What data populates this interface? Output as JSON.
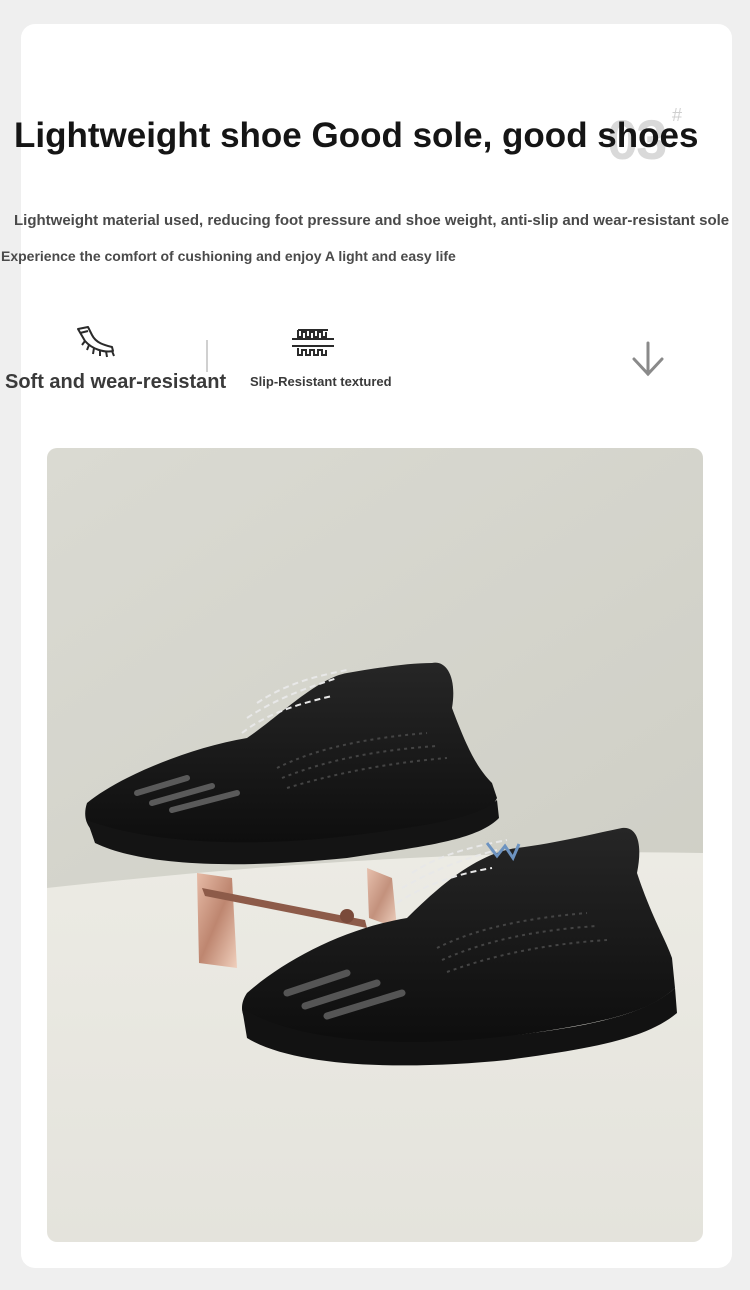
{
  "badge": {
    "number": "03",
    "hash": "#"
  },
  "headline": "Lightweight shoe Good sole, good shoes",
  "subtitle_1": "Lightweight material used, reducing foot pressure and shoe weight, anti-slip and wear-resistant sole",
  "subtitle_2": "Experience the comfort of cushioning and enjoy A light and easy life",
  "features": [
    {
      "label": "Soft and wear-resistant",
      "icon": "sole-flex-icon"
    },
    {
      "label": "Slip-Resistant textured",
      "icon": "tread-pattern-icon"
    },
    {
      "label": "",
      "icon": "arrow-down-icon"
    }
  ],
  "photo": {
    "subject": "pair of black knit sneakers on acrylic display stand",
    "colors": {
      "wall": "#d8d8ce",
      "floor": "#ecebe4",
      "shoe": "#151515",
      "stand": "#c9917a"
    }
  }
}
